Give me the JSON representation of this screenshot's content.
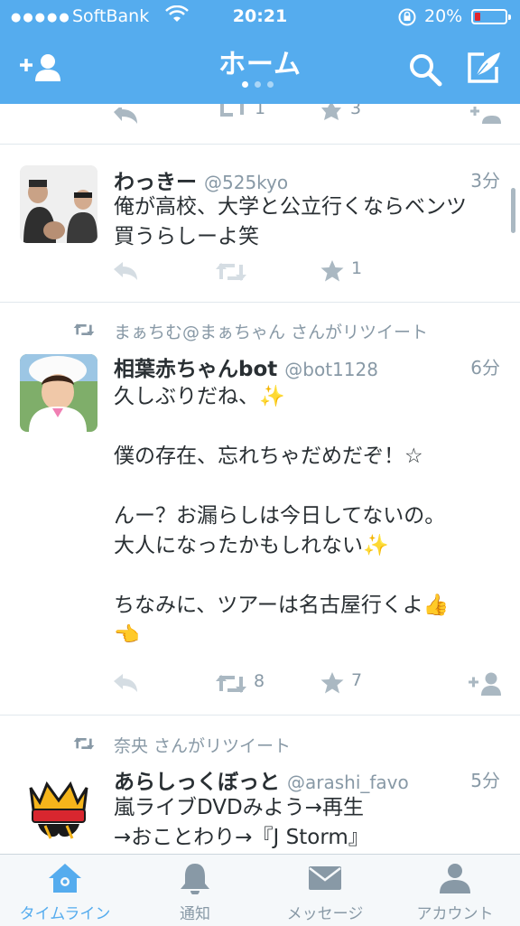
{
  "status_bar": {
    "carrier": "SoftBank",
    "time": "20:21",
    "battery_percent": "20%",
    "battery_level": 0.2
  },
  "header": {
    "title": "ホーム",
    "page_count": 3,
    "page_index": 0,
    "icons": [
      "add-user-icon",
      "search-icon",
      "compose-icon"
    ]
  },
  "timeline": {
    "partial_top": {
      "retweets": "1",
      "favorites": "3"
    },
    "tweets": [
      {
        "name": "わっきー",
        "handle": "@525kyo",
        "time": "3分",
        "text": "俺が高校、大学と公立行くならベンツ\n買うらしーよ笑",
        "retweets": "",
        "favorites": "1"
      },
      {
        "retweeted_by": "まぁちむ@まぁちゃん さんがリツイート",
        "name": "相葉赤ちゃんbot",
        "handle": "@bot1128",
        "time": "6分",
        "text": "久しぶりだね、✨\n\n僕の存在、忘れちゃだめだぞ！☆\n\nんー？お漏らしは今日してないの。\n大人になったかもしれない✨\n\nちなみに、ツアーは名古屋行くよ👍\n👈",
        "retweets": "8",
        "favorites": "7"
      },
      {
        "retweeted_by": "奈央 さんがリツイート",
        "name": "あらしっくぼっと",
        "handle": "@arashi_favo",
        "time": "5分",
        "text": "嵐ライブDVDみよう→再生\n→おことわり→『J Storm』"
      }
    ]
  },
  "tabbar": {
    "tabs": [
      {
        "label": "タイムライン",
        "icon": "home-icon",
        "active": true
      },
      {
        "label": "通知",
        "icon": "bell-icon",
        "active": false
      },
      {
        "label": "メッセージ",
        "icon": "envelope-icon",
        "active": false
      },
      {
        "label": "アカウント",
        "icon": "person-icon",
        "active": false
      }
    ]
  },
  "colors": {
    "brand": "#55acee",
    "text": "#292f33",
    "muted": "#8899a6",
    "battery_low": "#e0262d"
  }
}
